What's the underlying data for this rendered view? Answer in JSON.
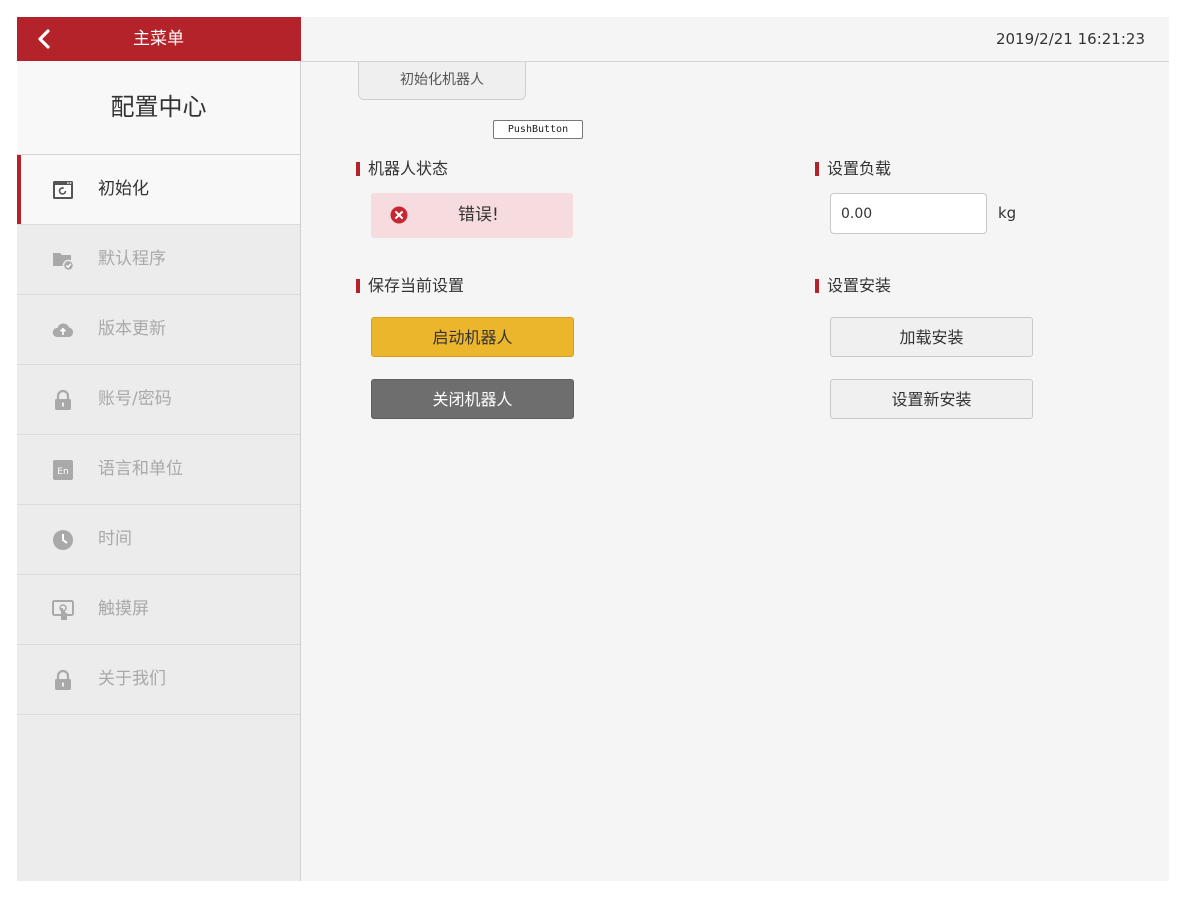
{
  "header": {
    "menu_title": "主菜单",
    "datetime": "2019/2/21 16:21:23"
  },
  "sidebar": {
    "title": "配置中心",
    "items": [
      {
        "label": "初始化",
        "icon": "init-window-icon",
        "active": true
      },
      {
        "label": "默认程序",
        "icon": "folder-check-icon",
        "active": false
      },
      {
        "label": "版本更新",
        "icon": "cloud-upload-icon",
        "active": false
      },
      {
        "label": "账号/密码",
        "icon": "lock-icon",
        "active": false
      },
      {
        "label": "语言和单位",
        "icon": "language-en-icon",
        "active": false
      },
      {
        "label": "时间",
        "icon": "clock-icon",
        "active": false
      },
      {
        "label": "触摸屏",
        "icon": "touchscreen-icon",
        "active": false
      },
      {
        "label": "关于我们",
        "icon": "lock-icon",
        "active": false
      }
    ]
  },
  "main": {
    "init_button": "初始化机器人",
    "push_button": "PushButton",
    "robot_status": {
      "title": "机器人状态",
      "value": "错误!"
    },
    "payload": {
      "title": "设置负载",
      "value": "0.00",
      "unit": "kg"
    },
    "save_settings": {
      "title": "保存当前设置",
      "start_label": "启动机器人",
      "stop_label": "关闭机器人"
    },
    "installation": {
      "title": "设置安装",
      "load_label": "加载安装",
      "new_label": "设置新安装"
    }
  },
  "colors": {
    "accent": "#b5232a",
    "start_button": "#ecb62c",
    "stop_button": "#6e6e6e",
    "error_bg": "#f6dcde",
    "error_icon": "#c62832"
  }
}
